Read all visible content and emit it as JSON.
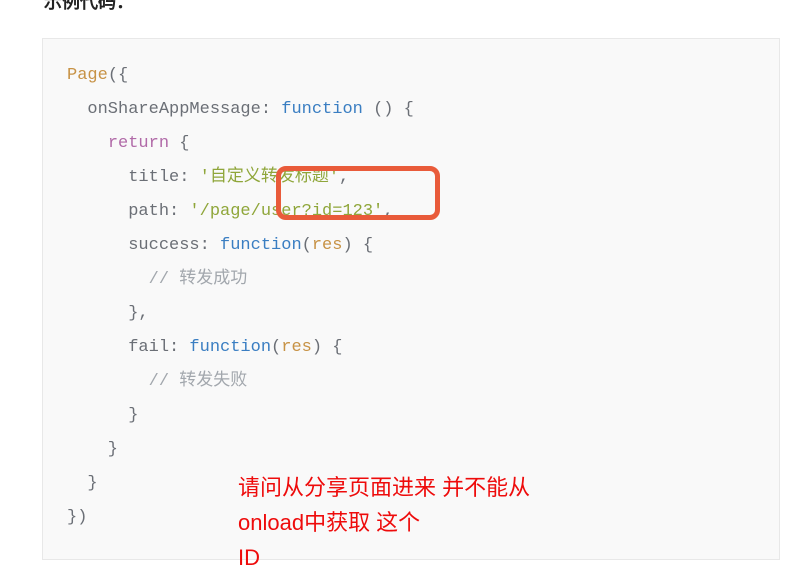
{
  "heading": "示例代码：",
  "code": {
    "l1_a": "Page",
    "l1_b": "({",
    "l2_a": "  onShareAppMessage: ",
    "l2_b": "function",
    "l2_c": " () {",
    "l3_a": "    ",
    "l3_b": "return",
    "l3_c": " {",
    "l4_a": "      title: ",
    "l4_b": "'自定义转发标题'",
    "l4_c": ",",
    "l5_a": "      path: ",
    "l5_b": "'/page/user?id=123'",
    "l5_c": ",",
    "l6_a": "      success: ",
    "l6_b": "function",
    "l6_c": "(",
    "l6_d": "res",
    "l6_e": ") {",
    "l7_a": "        ",
    "l7_b": "// 转发成功",
    "l8_a": "      },",
    "l9_a": "      fail: ",
    "l9_b": "function",
    "l9_c": "(",
    "l9_d": "res",
    "l9_e": ") {",
    "l10_a": "        ",
    "l10_b": "// 转发失败",
    "l11_a": "      }",
    "l12_a": "    }",
    "l13_a": "  }",
    "l14_a": "})"
  },
  "annotation": {
    "line1": "请问从分享页面进来 并不能从",
    "line2": "onload中获取 这个",
    "line3": "ID"
  },
  "colors": {
    "highlight_box": "#e95b3a",
    "annotation_text": "#ee0b0b"
  }
}
